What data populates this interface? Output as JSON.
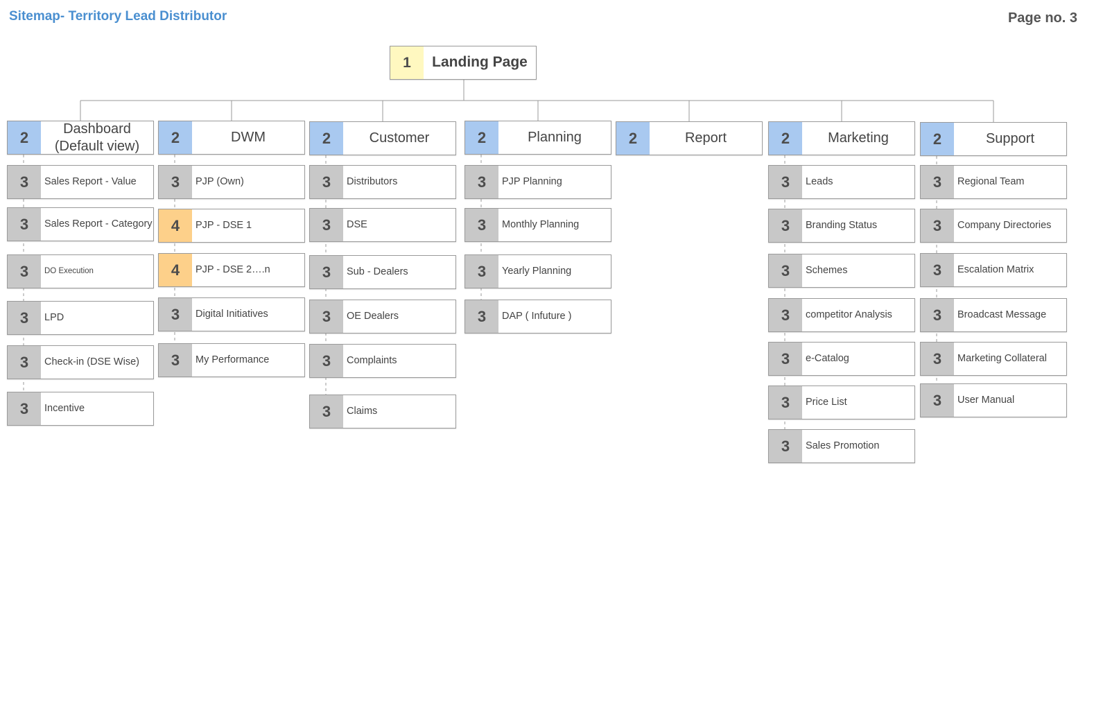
{
  "header": {
    "title": "Sitemap- Territory Lead Distributor",
    "page_no": "Page no. 3"
  },
  "root": {
    "num": "1",
    "label": "Landing Page"
  },
  "sections": [
    {
      "num": "2",
      "label": "Dashboard\n(Default view)",
      "children": [
        {
          "num": "3",
          "label": "Sales Report - Value"
        },
        {
          "num": "3",
          "label": "Sales Report - Category"
        },
        {
          "num": "3",
          "label": "DO  Execution"
        },
        {
          "num": "3",
          "label": " LPD"
        },
        {
          "num": "3",
          "label": "Check-in (DSE Wise)"
        },
        {
          "num": "3",
          "label": "Incentive"
        }
      ]
    },
    {
      "num": "2",
      "label": "DWM",
      "children": [
        {
          "num": "3",
          "label": "PJP (Own)"
        },
        {
          "num": "4",
          "label": "PJP - DSE 1"
        },
        {
          "num": "4",
          "label": "PJP - DSE 2….n"
        },
        {
          "num": "3",
          "label": "Digital Initiatives"
        },
        {
          "num": "3",
          "label": "My Performance"
        }
      ]
    },
    {
      "num": "2",
      "label": "Customer",
      "children": [
        {
          "num": "3",
          "label": "Distributors"
        },
        {
          "num": "3",
          "label": "DSE"
        },
        {
          "num": "3",
          "label": "Sub - Dealers"
        },
        {
          "num": "3",
          "label": "OE Dealers"
        },
        {
          "num": "3",
          "label": "Complaints"
        },
        {
          "num": "3",
          "label": "Claims"
        }
      ]
    },
    {
      "num": "2",
      "label": "Planning",
      "children": [
        {
          "num": "3",
          "label": "PJP Planning"
        },
        {
          "num": "3",
          "label": "Monthly Planning"
        },
        {
          "num": "3",
          "label": "Yearly Planning"
        },
        {
          "num": "3",
          "label": "DAP ( Infuture )"
        }
      ]
    },
    {
      "num": "2",
      "label": "Report",
      "children": []
    },
    {
      "num": "2",
      "label": "Marketing",
      "children": [
        {
          "num": "3",
          "label": "Leads"
        },
        {
          "num": "3",
          "label": "Branding Status"
        },
        {
          "num": "3",
          "label": "Schemes"
        },
        {
          "num": "3",
          "label": "competitor Analysis"
        },
        {
          "num": "3",
          "label": "e-Catalog"
        },
        {
          "num": "3",
          "label": "Price List"
        },
        {
          "num": "3",
          "label": "Sales Promotion"
        }
      ]
    },
    {
      "num": "2",
      "label": "Support",
      "children": [
        {
          "num": "3",
          "label": "Regional Team"
        },
        {
          "num": "3",
          "label": "Company Directories"
        },
        {
          "num": "3",
          "label": "Escalation Matrix"
        },
        {
          "num": "3",
          "label": "Broadcast Message"
        },
        {
          "num": "3",
          "label": "Marketing Collateral"
        },
        {
          "num": "3",
          "label": "User Manual"
        }
      ]
    }
  ],
  "colors": {
    "title": "#4a8fd0",
    "level1": "#fff8c0",
    "level2": "#a9c9f0",
    "level3": "#c8c8c8",
    "level4": "#fdd08a",
    "line": "#9a9a9a"
  }
}
